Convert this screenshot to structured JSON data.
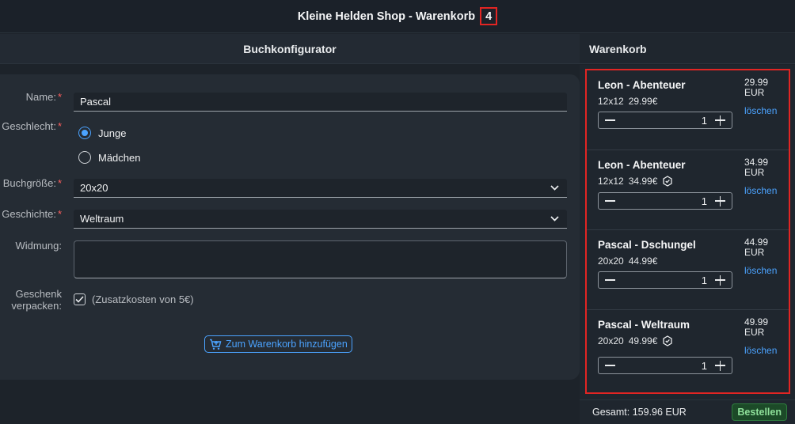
{
  "titlebar": {
    "title": "Kleine Helden Shop - Warenkorb",
    "count": "4"
  },
  "configurator": {
    "header": "Buchkonfigurator",
    "name_label": "Name:",
    "name_value": "Pascal",
    "gender_label": "Geschlecht:",
    "gender_options": [
      "Junge",
      "Mädchen"
    ],
    "gender_selected": "Junge",
    "size_label": "Buchgröße:",
    "size_value": "20x20",
    "story_label": "Geschichte:",
    "story_value": "Weltraum",
    "dedication_label": "Widmung:",
    "dedication_value": "",
    "gift_label_1": "Geschenk",
    "gift_label_2": "verpacken:",
    "gift_text": "(Zusatzkosten von 5€)",
    "gift_checked": true,
    "add_button": "Zum Warenkorb hinzufügen",
    "required_mark": "*"
  },
  "cart": {
    "header": "Warenkorb",
    "items": [
      {
        "name": "Leon - Abenteuer",
        "size": "12x12",
        "price_text": "29.99€",
        "price": "29.99",
        "currency": "EUR",
        "delete": "löschen",
        "qty": "1",
        "dedication_icon": false
      },
      {
        "name": "Leon - Abenteuer",
        "size": "12x12",
        "price_text": "34.99€",
        "price": "34.99",
        "currency": "EUR",
        "delete": "löschen",
        "qty": "1",
        "dedication_icon": true
      },
      {
        "name": "Pascal - Dschungel",
        "size": "20x20",
        "price_text": "44.99€",
        "price": "44.99",
        "currency": "EUR",
        "delete": "löschen",
        "qty": "1",
        "dedication_icon": false
      },
      {
        "name": "Pascal - Weltraum",
        "size": "20x20",
        "price_text": "49.99€",
        "price": "49.99",
        "currency": "EUR",
        "delete": "löschen",
        "qty": "1",
        "dedication_icon": true
      }
    ],
    "total": "Gesamt: 159.96 EUR",
    "order_button": "Bestellen"
  },
  "colors": {
    "accent": "#4ba3ff",
    "highlight": "#e22523",
    "order": "#2e7d3e"
  }
}
